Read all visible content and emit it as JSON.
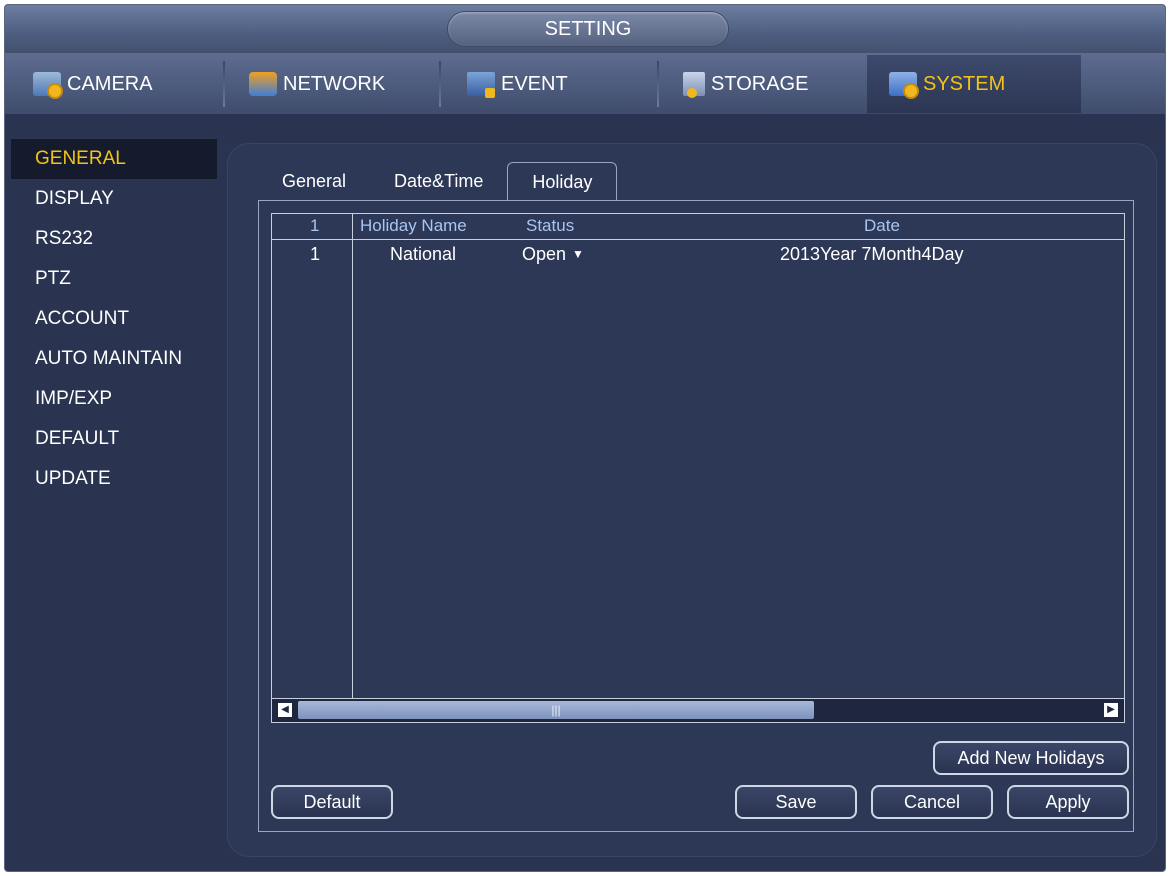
{
  "window": {
    "title": "SETTING"
  },
  "topnav": [
    {
      "label": "CAMERA",
      "icon": "camera-icon"
    },
    {
      "label": "NETWORK",
      "icon": "network-icon"
    },
    {
      "label": "EVENT",
      "icon": "event-icon"
    },
    {
      "label": "STORAGE",
      "icon": "storage-icon"
    },
    {
      "label": "SYSTEM",
      "icon": "system-icon",
      "active": true
    }
  ],
  "sidebar": {
    "items": [
      {
        "label": "GENERAL",
        "active": true
      },
      {
        "label": "DISPLAY"
      },
      {
        "label": "RS232"
      },
      {
        "label": "PTZ"
      },
      {
        "label": "ACCOUNT"
      },
      {
        "label": "AUTO MAINTAIN"
      },
      {
        "label": "IMP/EXP"
      },
      {
        "label": "DEFAULT"
      },
      {
        "label": "UPDATE"
      }
    ]
  },
  "tabs": [
    {
      "label": "General"
    },
    {
      "label": "Date&Time"
    },
    {
      "label": "Holiday",
      "active": true
    }
  ],
  "holiday_table": {
    "columns": [
      "1",
      "Holiday Name",
      "Status",
      "Date"
    ],
    "rows": [
      {
        "index": "1",
        "name": "National",
        "status": "Open",
        "date": "2013Year 7Month4Day"
      }
    ],
    "scrollbar_grip": "|||"
  },
  "buttons": {
    "add_new": "Add New Holidays",
    "default": "Default",
    "save": "Save",
    "cancel": "Cancel",
    "apply": "Apply"
  },
  "colors": {
    "accent": "#f2c318",
    "background": "#2a3450",
    "header_text": "#a8c6f2"
  }
}
